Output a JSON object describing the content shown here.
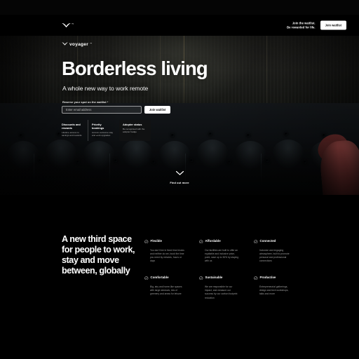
{
  "topbar": {
    "logo_name": "voyager",
    "trademark": "™",
    "message_line1": "Join the waitlist.",
    "message_line2": "Be rewarded for life.",
    "cta_label": "Join waitlist"
  },
  "hero": {
    "brand": "voyager",
    "trademark": "™",
    "headline": "Borderless living",
    "subhead": "A whole new way to work remote",
    "form": {
      "label": "Reserve your spot on the waitlist *",
      "email_value": "",
      "email_placeholder": "Enter email address",
      "submit_label": "Join waitlist"
    },
    "benefits": [
      {
        "title": "Discounts and rewards",
        "body": "Lifetime access to savings and rewards"
      },
      {
        "title": "Priority bookings",
        "body": "Access exclusive stay and work upgrades"
      },
      {
        "title": "Adopter status",
        "body": "Be recognised with the adopter badge"
      }
    ],
    "scroll_cue": "Find out more"
  },
  "section": {
    "heading": "A new third space for people to work, stay and move between, globally",
    "features": [
      {
        "title": "Flexible",
        "body": "You don't live in fixed time blocks and neither do we, book the time you need by minutes, hours or days"
      },
      {
        "title": "Affordable",
        "body": "Our facilities are built to offer an equitable and inclusive price-point, save up to 30% by staying with us"
      },
      {
        "title": "Connected",
        "body": "Inclusive and engaging atmosphere, built to promote personal and professional connections"
      },
      {
        "title": "Comfortable",
        "body": "Big, airy and home-like spaces with large windows, lots of greenery and areas for leisure"
      },
      {
        "title": "Sustainable",
        "body": "We are responsible for our impact, and measure our success by our carbon footprint reduction"
      },
      {
        "title": "Productive",
        "body": "Entrepreneurial gatherings, design and tech workshops, talks and more"
      }
    ]
  },
  "colors": {
    "background": "#000000",
    "text": "#ffffff",
    "muted_text": "#9a9a9a",
    "accent_button": "#ffffff",
    "sweater": "#8d3f3d"
  }
}
